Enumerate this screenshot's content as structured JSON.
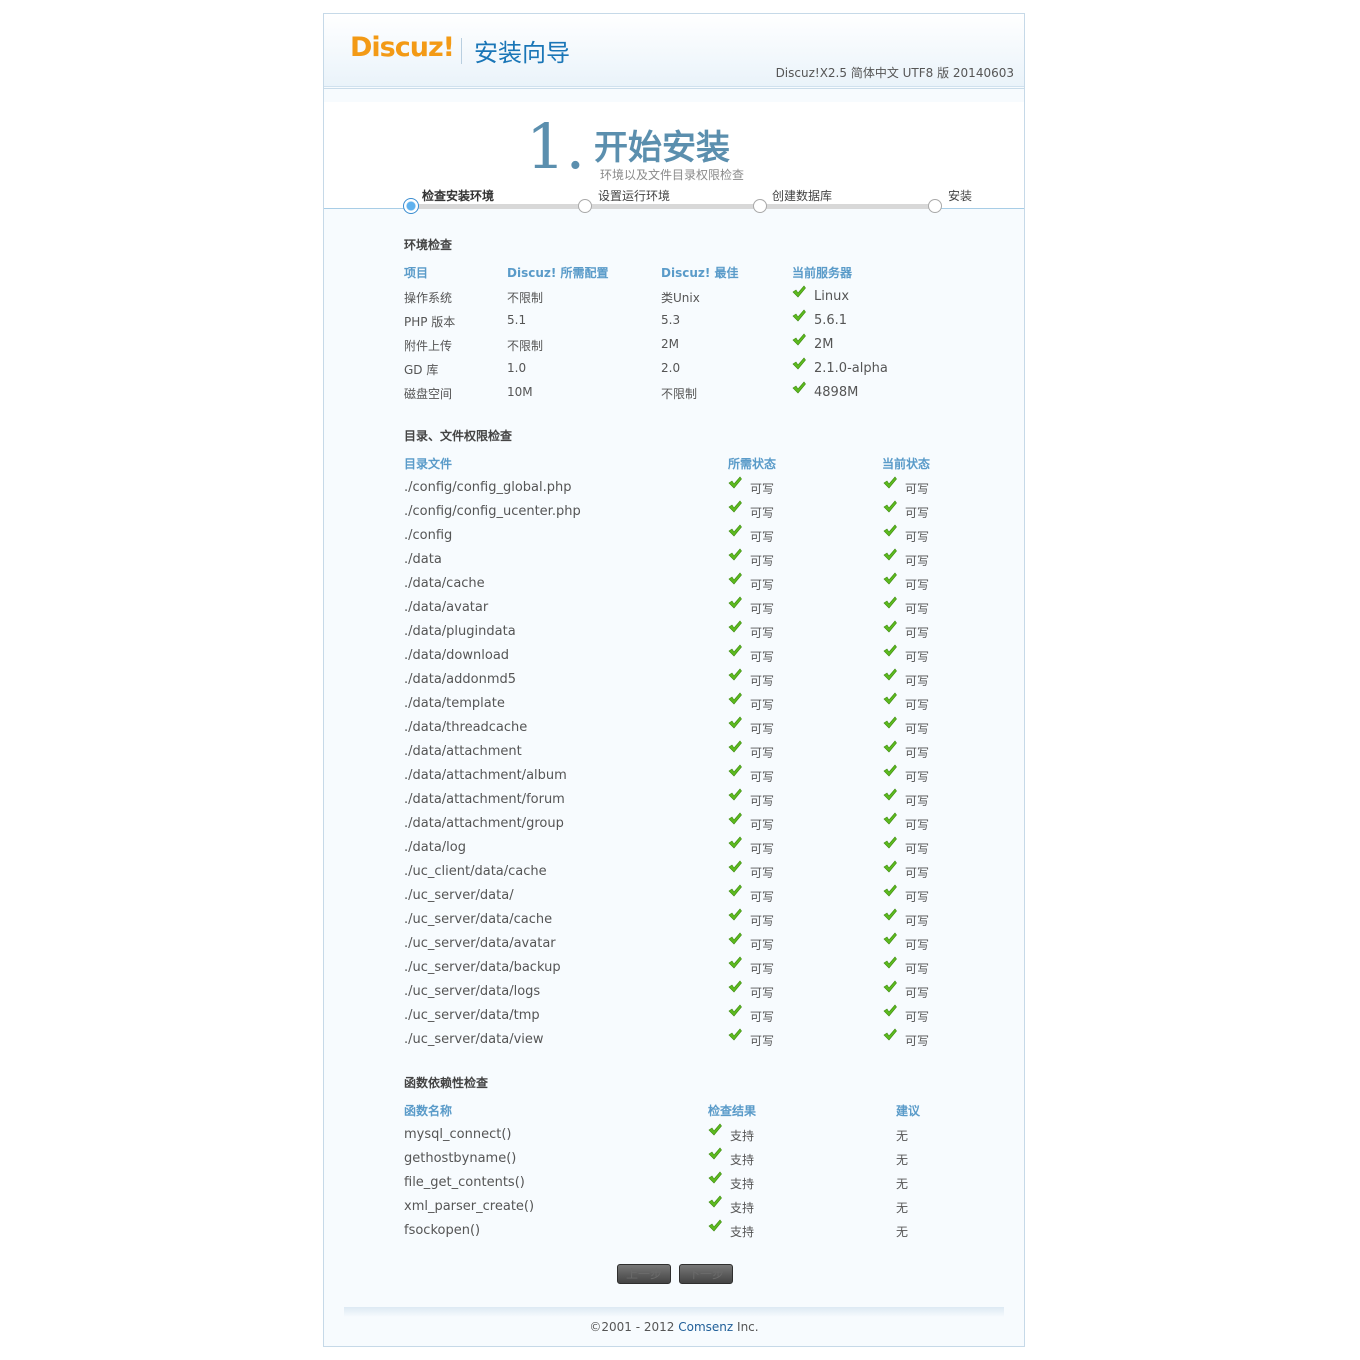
{
  "header": {
    "logo": "Discuz!",
    "wizard_title": "安装向导",
    "version": "Discuz!X2.5 简体中文 UTF8 版 20140603"
  },
  "step": {
    "number": "1.",
    "title": "开始安装",
    "description": "环境以及文件目录权限检查"
  },
  "progress": {
    "current_index": 0,
    "steps": [
      "检查安装环境",
      "设置运行环境",
      "创建数据库",
      "安装"
    ]
  },
  "env_check": {
    "title": "环境检查",
    "headers": [
      "项目",
      "Discuz! 所需配置",
      "Discuz! 最佳",
      "当前服务器"
    ],
    "rows": [
      {
        "item": "操作系统",
        "required": "不限制",
        "best": "类Unix",
        "current": "Linux"
      },
      {
        "item": "PHP 版本",
        "required": "5.1",
        "best": "5.3",
        "current": "5.6.1"
      },
      {
        "item": "附件上传",
        "required": "不限制",
        "best": "2M",
        "current": "2M"
      },
      {
        "item": "GD 库",
        "required": "1.0",
        "best": "2.0",
        "current": "2.1.0-alpha"
      },
      {
        "item": "磁盘空间",
        "required": "10M",
        "best": "不限制",
        "current": "4898M"
      }
    ]
  },
  "dir_check": {
    "title": "目录、文件权限检查",
    "headers": [
      "目录文件",
      "所需状态",
      "当前状态"
    ],
    "status_text": "可写",
    "rows": [
      "./config/config_global.php",
      "./config/config_ucenter.php",
      "./config",
      "./data",
      "./data/cache",
      "./data/avatar",
      "./data/plugindata",
      "./data/download",
      "./data/addonmd5",
      "./data/template",
      "./data/threadcache",
      "./data/attachment",
      "./data/attachment/album",
      "./data/attachment/forum",
      "./data/attachment/group",
      "./data/log",
      "./uc_client/data/cache",
      "./uc_server/data/",
      "./uc_server/data/cache",
      "./uc_server/data/avatar",
      "./uc_server/data/backup",
      "./uc_server/data/logs",
      "./uc_server/data/tmp",
      "./uc_server/data/view"
    ]
  },
  "func_check": {
    "title": "函数依赖性检查",
    "headers": [
      "函数名称",
      "检查结果",
      "建议"
    ],
    "rows": [
      {
        "name": "mysql_connect()",
        "result": "支持",
        "advice": "无"
      },
      {
        "name": "gethostbyname()",
        "result": "支持",
        "advice": "无"
      },
      {
        "name": "file_get_contents()",
        "result": "支持",
        "advice": "无"
      },
      {
        "name": "xml_parser_create()",
        "result": "支持",
        "advice": "无"
      },
      {
        "name": "fsockopen()",
        "result": "支持",
        "advice": "无"
      }
    ]
  },
  "buttons": {
    "prev": "上一步",
    "next": "下一步"
  },
  "footer": {
    "copyright": "©2001 - 2012 ",
    "company": "Comsenz",
    "suffix": " Inc."
  },
  "colors": {
    "accent": "#5a9bc9",
    "logo": "#f39a15",
    "check": "#5dbb1f"
  }
}
